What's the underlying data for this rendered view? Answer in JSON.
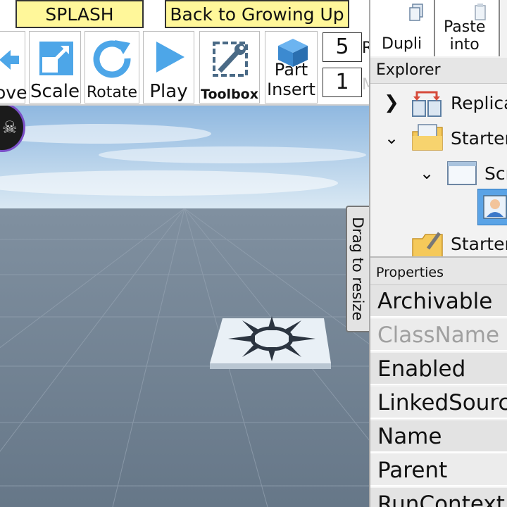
{
  "tabs": {
    "splash": "SPLASH",
    "back": "Back to Growing Up"
  },
  "toolbar": {
    "move": "ove",
    "scale": "Scale",
    "rotate": "Rotate",
    "play": "Play",
    "toolbox": "Toolbox",
    "part_insert_line1": "Part",
    "part_insert_line2": "Insert",
    "rotate_increment": "5",
    "move_increment": "1",
    "rotate_increment_label": "R",
    "move_increment_label": "Move"
  },
  "right_panel": {
    "duplicate": "Dupli",
    "paste_into_line1": "Paste",
    "paste_into_line2": "into",
    "explorer_title": "Explorer",
    "tree": [
      {
        "label": "Replica",
        "icon": "replicated-storage-icon",
        "expander": "chevron-right"
      },
      {
        "label": "Starter",
        "icon": "folder-icon",
        "expander": "chevron-down"
      },
      {
        "label": "Scr",
        "icon": "screen-gui-icon",
        "expander": "chevron-down"
      },
      {
        "label": "",
        "icon": "user-icon",
        "expander": "none"
      },
      {
        "label": "Starter",
        "icon": "starter-pack-icon",
        "expander": "none"
      }
    ],
    "properties_title": "Properties",
    "properties": [
      {
        "name": "Archivable",
        "disabled": false
      },
      {
        "name": "ClassName",
        "disabled": true
      },
      {
        "name": "Enabled",
        "disabled": false
      },
      {
        "name": "LinkedSourc",
        "disabled": false
      },
      {
        "name": "Name",
        "disabled": false
      },
      {
        "name": "Parent",
        "disabled": false
      },
      {
        "name": "RunContext",
        "disabled": false
      }
    ]
  },
  "drag_handle": "Drag to resize",
  "colors": {
    "tab_bg": "#fff79a",
    "sky": "#a8cbea",
    "baseplate": "#6f7f8f",
    "accent": "#3b8fd8"
  }
}
